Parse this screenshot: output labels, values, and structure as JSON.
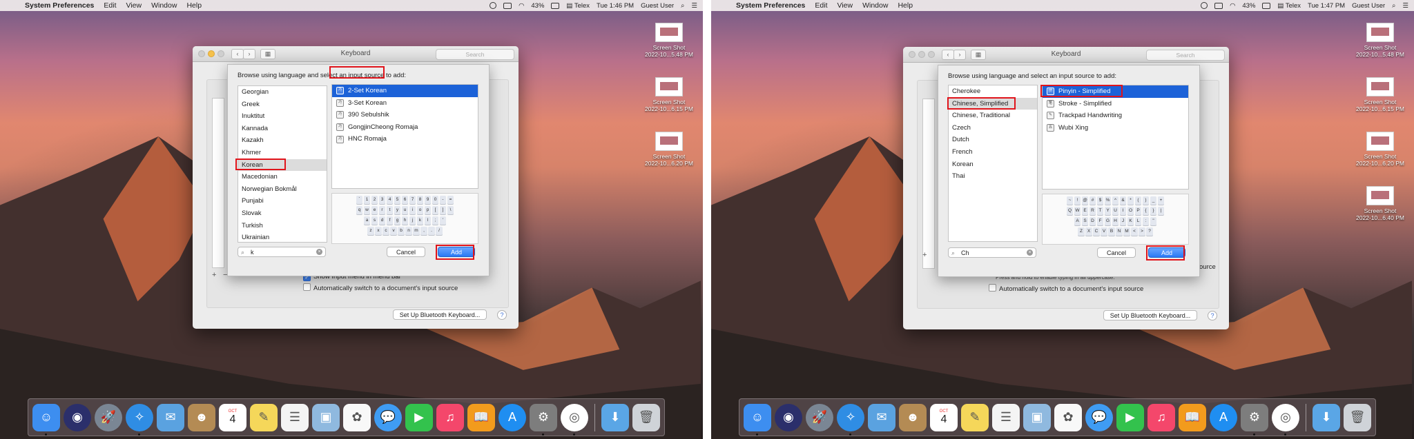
{
  "panels": [
    {
      "menubar": {
        "app": "System Preferences",
        "items": [
          "Edit",
          "View",
          "Window",
          "Help"
        ],
        "battery": "43%",
        "input_source": "Telex",
        "time": "Tue 1:46 PM",
        "user": "Guest User"
      },
      "desktop_icons": [
        {
          "line1": "Screen Shot",
          "line2": "2022-10...5.48 PM"
        },
        {
          "line1": "Screen Shot",
          "line2": "2022-10...6.15 PM"
        },
        {
          "line1": "Screen Shot",
          "line2": "2022-10...6.20 PM"
        }
      ],
      "window": {
        "title": "Keyboard",
        "search_placeholder": "Search",
        "show_input_menu": "Show Input menu in menu bar",
        "auto_switch": "Automatically switch to a document's input source",
        "bluetooth_button": "Set Up Bluetooth Keyboard...",
        "help": "?"
      },
      "sheet": {
        "prompt": "Browse using language and select an input source to add:",
        "languages": [
          "Georgian",
          "Greek",
          "Inuktitut",
          "Kannada",
          "Kazakh",
          "Khmer",
          "Korean",
          "Macedonian",
          "Norwegian Bokmål",
          "Punjabi",
          "Slovak",
          "Turkish",
          "Ukrainian"
        ],
        "selected_language": "Korean",
        "sources": [
          "2-Set Korean",
          "3-Set Korean",
          "390 Sebulshik",
          "GongjinCheong Romaja",
          "HNC Romaja"
        ],
        "selected_source": "2-Set Korean",
        "keyboard_rows": [
          [
            "`",
            "1",
            "2",
            "3",
            "4",
            "5",
            "6",
            "7",
            "8",
            "9",
            "0",
            "-",
            "="
          ],
          [
            "q",
            "w",
            "e",
            "r",
            "t",
            "y",
            "u",
            "i",
            "o",
            "p",
            "[",
            "]",
            "\\"
          ],
          [
            "a",
            "s",
            "d",
            "f",
            "g",
            "h",
            "j",
            "k",
            "l",
            ";",
            "'"
          ],
          [
            "z",
            "x",
            "c",
            "v",
            "b",
            "n",
            "m",
            ",",
            ".",
            "/"
          ]
        ],
        "search_value": "k",
        "cancel": "Cancel",
        "add": "Add"
      }
    },
    {
      "menubar": {
        "app": "System Preferences",
        "items": [
          "Edit",
          "View",
          "Window",
          "Help"
        ],
        "battery": "43%",
        "input_source": "Telex",
        "time": "Tue 1:47 PM",
        "user": "Guest User"
      },
      "desktop_icons": [
        {
          "line1": "Screen Shot",
          "line2": "2022-10...5.48 PM"
        },
        {
          "line1": "Screen Shot",
          "line2": "2022-10...6.15 PM"
        },
        {
          "line1": "Screen Shot",
          "line2": "2022-10...6.20 PM"
        },
        {
          "line1": "Screen Shot",
          "line2": "2022-10...6.40 PM"
        }
      ],
      "window": {
        "title": "Keyboard",
        "search_placeholder": "Search",
        "show_input_menu": "Press and hold to enable typing in all uppercase.",
        "auto_switch": "Automatically switch to a document's input source",
        "bluetooth_button": "Set Up Bluetooth Keyboard...",
        "help": "?",
        "source_fragment": "ource"
      },
      "sheet": {
        "prompt": "Browse using language and select an input source to add:",
        "languages": [
          "Cherokee",
          "Chinese, Simplified",
          "Chinese, Traditional",
          "Czech",
          "Dutch",
          "French",
          "Korean",
          "Thai"
        ],
        "selected_language": "Chinese, Simplified",
        "sources": [
          "Pinyin - Simplified",
          "Stroke - Simplified",
          "Trackpad Handwriting",
          "Wubi Xing"
        ],
        "selected_source": "Pinyin - Simplified",
        "keyboard_rows": [
          [
            "~",
            "!",
            "@",
            "#",
            "$",
            "%",
            "^",
            "&",
            "*",
            "(",
            ")",
            "_",
            "+"
          ],
          [
            "Q",
            "W",
            "E",
            "R",
            "T",
            "Y",
            "U",
            "I",
            "O",
            "P",
            "{",
            "}",
            "|"
          ],
          [
            "A",
            "S",
            "D",
            "F",
            "G",
            "H",
            "J",
            "K",
            "L",
            ":",
            "\""
          ],
          [
            "Z",
            "X",
            "C",
            "V",
            "B",
            "N",
            "M",
            "<",
            ">",
            "?"
          ]
        ],
        "search_value": "Ch",
        "cancel": "Cancel",
        "add": "Add"
      }
    }
  ],
  "dock_apps": [
    {
      "name": "finder-icon",
      "color": "#3d8ef0",
      "glyph": "☺"
    },
    {
      "name": "siri-icon",
      "color": "#2b2f6b",
      "glyph": "◉"
    },
    {
      "name": "launchpad-icon",
      "color": "#7a8694",
      "glyph": "🚀"
    },
    {
      "name": "safari-icon",
      "color": "#2f8de4",
      "glyph": "✧"
    },
    {
      "name": "mail-icon",
      "color": "#5aa2e0",
      "glyph": "✉"
    },
    {
      "name": "contacts-icon",
      "color": "#b48b54",
      "glyph": "☻"
    },
    {
      "name": "calendar-icon",
      "color": "#ffffff",
      "glyph": "4"
    },
    {
      "name": "notes-icon",
      "color": "#f5d75a",
      "glyph": "✎"
    },
    {
      "name": "reminders-icon",
      "color": "#f4f4f4",
      "glyph": "☰"
    },
    {
      "name": "preview-icon",
      "color": "#8fb9df",
      "glyph": "▣"
    },
    {
      "name": "photos-icon",
      "color": "#f8f8f8",
      "glyph": "✿"
    },
    {
      "name": "messages-icon",
      "color": "#3f9cf3",
      "glyph": "💬"
    },
    {
      "name": "facetime-icon",
      "color": "#33c24d",
      "glyph": "▶"
    },
    {
      "name": "music-icon",
      "color": "#f4476b",
      "glyph": "♫"
    },
    {
      "name": "ibooks-icon",
      "color": "#f29b1d",
      "glyph": "📖"
    },
    {
      "name": "appstore-icon",
      "color": "#1f8ef1",
      "glyph": "A"
    },
    {
      "name": "system-preferences-icon",
      "color": "#7d7d7d",
      "glyph": "⚙"
    },
    {
      "name": "chrome-icon",
      "color": "#ffffff",
      "glyph": "◎"
    }
  ],
  "dock_right": [
    {
      "name": "downloads-folder-icon",
      "color": "#5aa6e6",
      "glyph": "⬇"
    },
    {
      "name": "trash-icon",
      "color": "#cfd3d8",
      "glyph": "🗑"
    }
  ],
  "calendar_month": "OCT",
  "highlight_color": "#e0131a"
}
